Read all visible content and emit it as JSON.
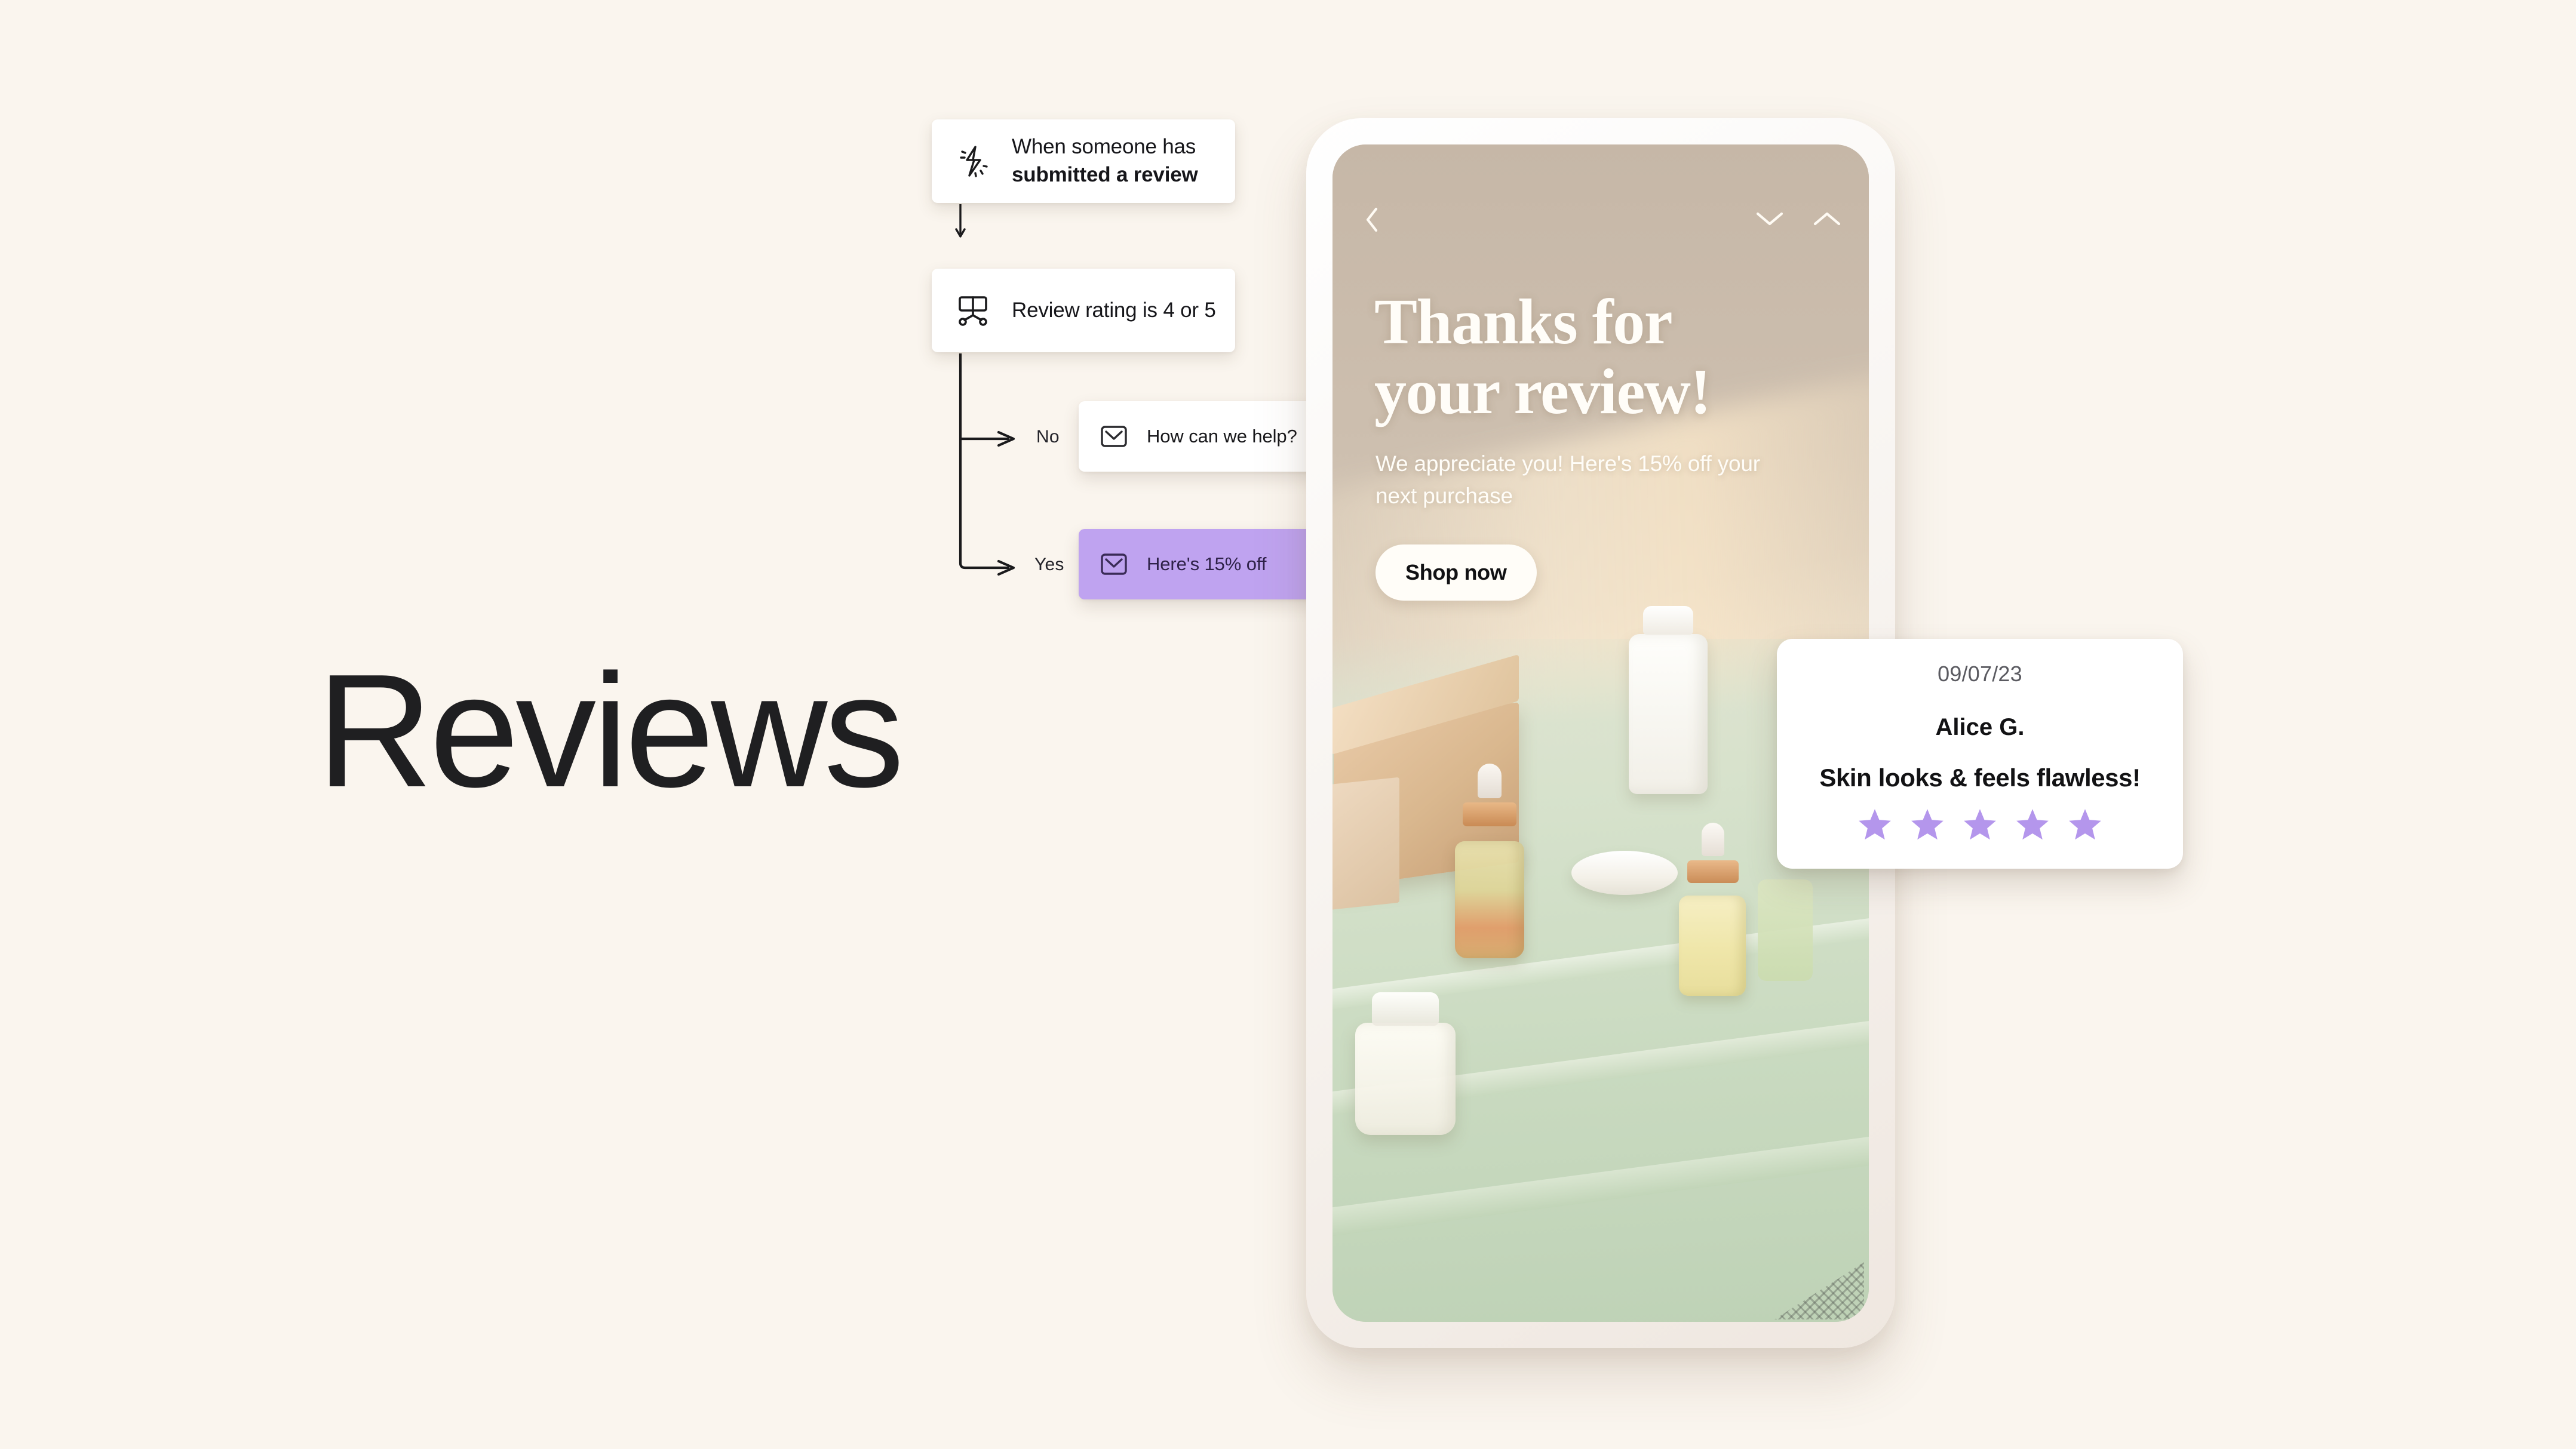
{
  "page": {
    "background_color": "#FAF5EE",
    "hero_title": "Reviews"
  },
  "flow": {
    "trigger": {
      "icon": "lightning-bolt-icon",
      "line_plain": "When someone has",
      "line_strong": "submitted a review"
    },
    "condition": {
      "icon": "branch-split-icon",
      "label": "Review rating is 4 or 5"
    },
    "branches": [
      {
        "label": "No",
        "icon": "envelope-icon",
        "action_label": "How can we help?",
        "card_color": "#FFFFFF"
      },
      {
        "label": "Yes",
        "icon": "envelope-icon",
        "action_label": "Here's 15% off",
        "card_color": "#BFA3F0"
      }
    ]
  },
  "phone": {
    "nav": {
      "back_icon": "chevron-left-icon",
      "down_icon": "chevron-down-icon",
      "up_icon": "chevron-up-icon"
    },
    "headline_line1": "Thanks for",
    "headline_line2": "your review!",
    "subtext": "We appreciate you! Here's 15% off your next purchase",
    "cta_label": "Shop now"
  },
  "review_card": {
    "date": "09/07/23",
    "author": "Alice G.",
    "text": "Skin looks & feels flawless!",
    "rating": 5,
    "star_color": "#B496EC"
  }
}
